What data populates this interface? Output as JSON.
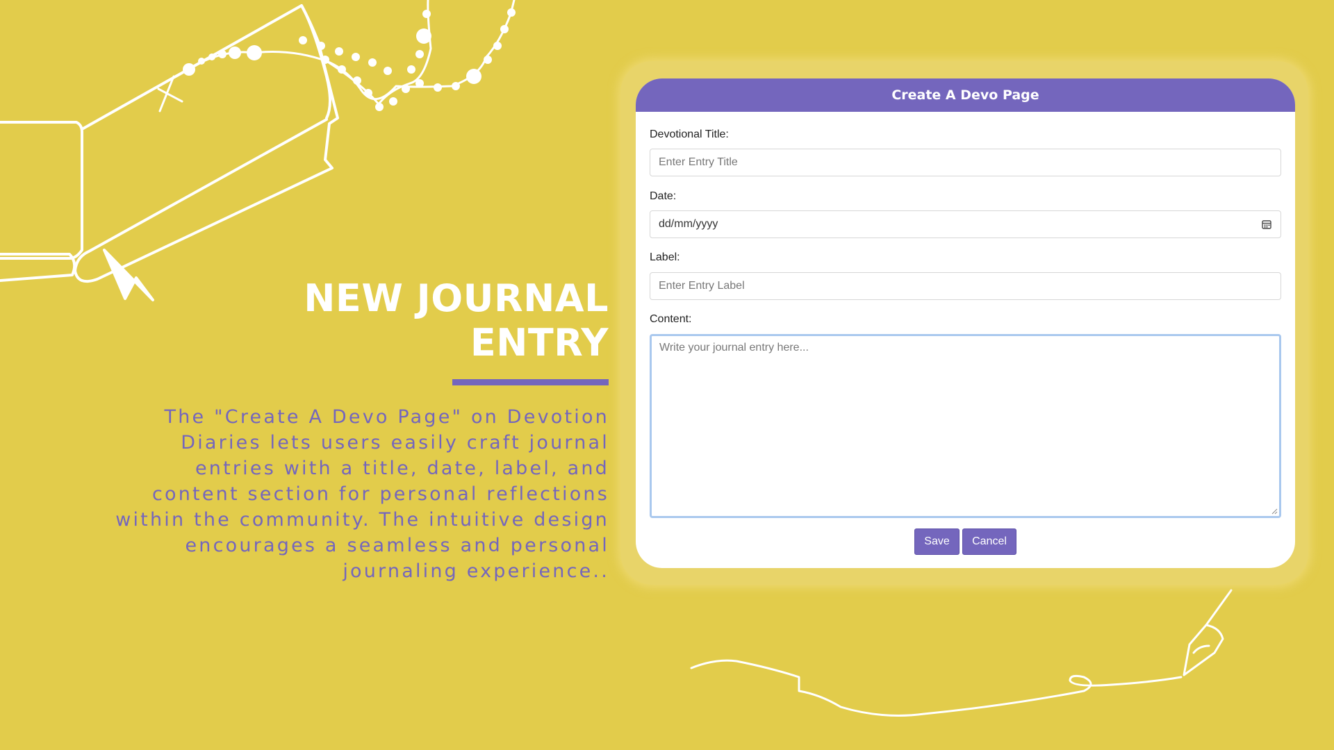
{
  "hero": {
    "title_line1": "NEW JOURNAL",
    "title_line2": "ENTRY",
    "description": "The \"Create A Devo Page\" on Devotion Diaries lets users easily craft journal entries with a title, date, label, and content section for personal reflections within the community. The intuitive design encourages a seamless and personal journaling experience.."
  },
  "form": {
    "header": "Create A Devo Page",
    "title_label": "Devotional Title:",
    "title_placeholder": "Enter Entry Title",
    "date_label": "Date:",
    "date_value": "dd/mm/yyyy",
    "label_label": "Label:",
    "label_placeholder": "Enter Entry Label",
    "content_label": "Content:",
    "content_placeholder": "Write your journal entry here...",
    "save_label": "Save",
    "cancel_label": "Cancel"
  },
  "colors": {
    "background": "#e2cc4b",
    "accent": "#7466bd",
    "card": "#ffffff"
  },
  "icons": [
    "calendar-icon",
    "bible-illustration",
    "rosary-illustration",
    "fountain-pen-illustration"
  ]
}
